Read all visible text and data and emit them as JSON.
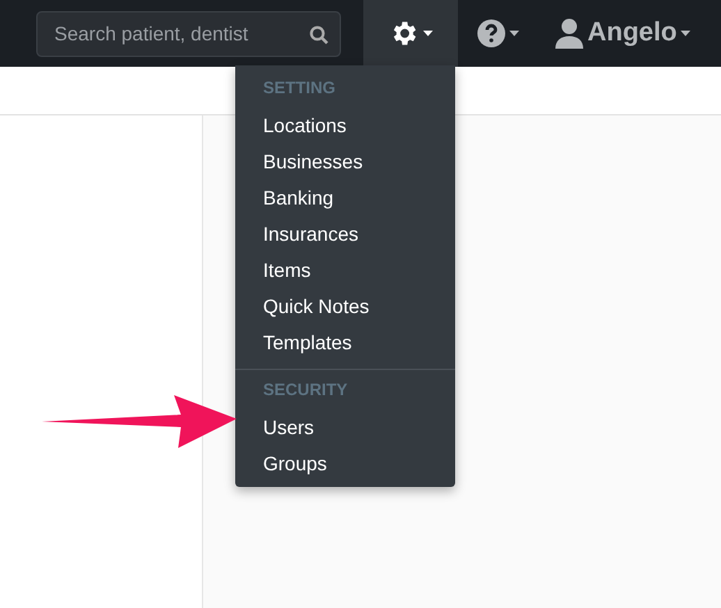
{
  "navbar": {
    "search": {
      "placeholder": "Search patient, dentist"
    },
    "settings": {
      "expanded": true
    },
    "help": {
      "expanded": false
    },
    "user": {
      "name": "Angelo"
    }
  },
  "settings_menu": {
    "sections": [
      {
        "header": "SETTING",
        "items": [
          "Locations",
          "Businesses",
          "Banking",
          "Insurances",
          "Items",
          "Quick Notes",
          "Templates"
        ]
      },
      {
        "header": "SECURITY",
        "items": [
          "Users",
          "Groups"
        ]
      }
    ]
  },
  "annotation": {
    "kind": "arrow",
    "color": "#f0145a"
  }
}
